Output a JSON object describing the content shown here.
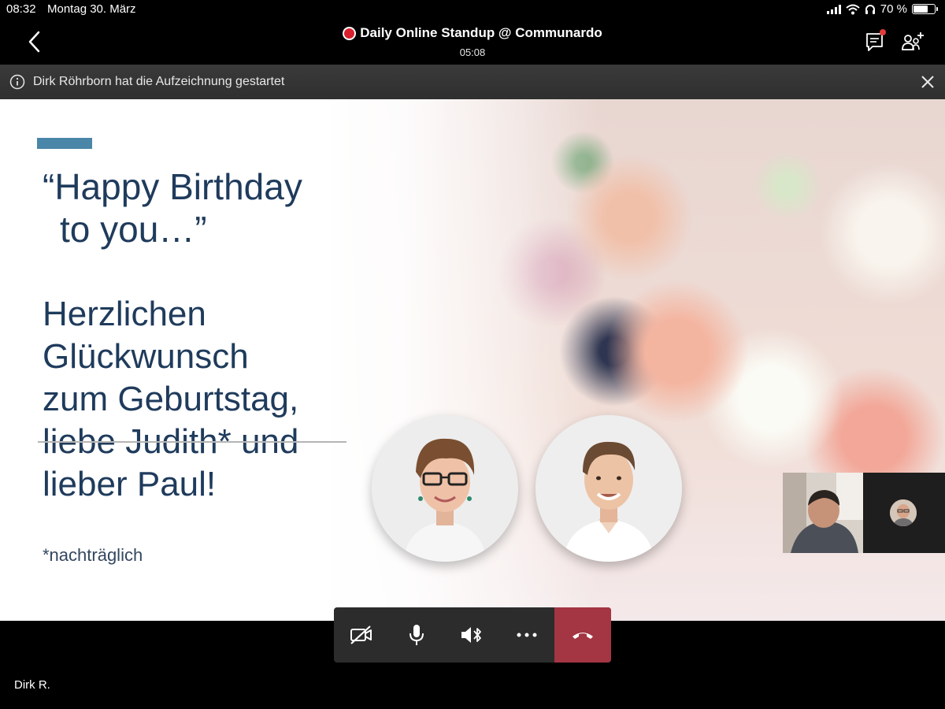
{
  "status_bar": {
    "time": "08:32",
    "date": "Montag 30. März",
    "battery": "70 %",
    "battery_level": 0.7
  },
  "call": {
    "title": "Daily Online Standup @ Communardo",
    "duration": "05:08",
    "recording_color": "#d8202f"
  },
  "header": {
    "back_icon": "chevron-left-icon",
    "chat_icon": "chat-icon",
    "people_icon": "add-people-icon"
  },
  "banner": {
    "message": "Dirk Röhrborn hat die Aufzeichnung gestartet",
    "info_icon": "info-icon",
    "close_icon": "close-icon"
  },
  "slide": {
    "quote_line1": "“Happy Birthday",
    "quote_line2": "to you…”",
    "greeting": [
      "Herzlichen",
      "Glückwunsch",
      "zum Geburtstag,",
      "liebe Judith* und",
      "lieber Paul!"
    ],
    "footnote": "*nachträglich",
    "accent_color": "#4a86a8",
    "text_color": "#1f3b5c"
  },
  "controls": {
    "video_icon": "camera-off-icon",
    "mic_icon": "microphone-icon",
    "speaker_icon": "speaker-bluetooth-icon",
    "more_icon": "more-icon",
    "hangup_icon": "hang-up-icon",
    "hangup_color": "#a43542"
  },
  "self_view": {
    "name": "Dirk R."
  }
}
